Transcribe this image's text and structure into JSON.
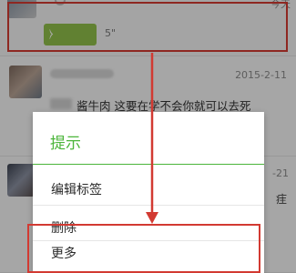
{
  "list": {
    "row1": {
      "voice_length": "5\"",
      "date": "今天"
    },
    "row2": {
      "date": "2015-2-11",
      "message": "酱牛肉 这要在学不会你就可以去死"
    },
    "row3": {
      "date": "-21",
      "side_text": "疰"
    }
  },
  "dialog": {
    "title": "提示",
    "items": [
      {
        "label": "编辑标签"
      },
      {
        "label": "删除"
      },
      {
        "label": "更多"
      }
    ]
  },
  "annotation": {
    "color": "#d23a32"
  },
  "accent": "#4bb53a"
}
